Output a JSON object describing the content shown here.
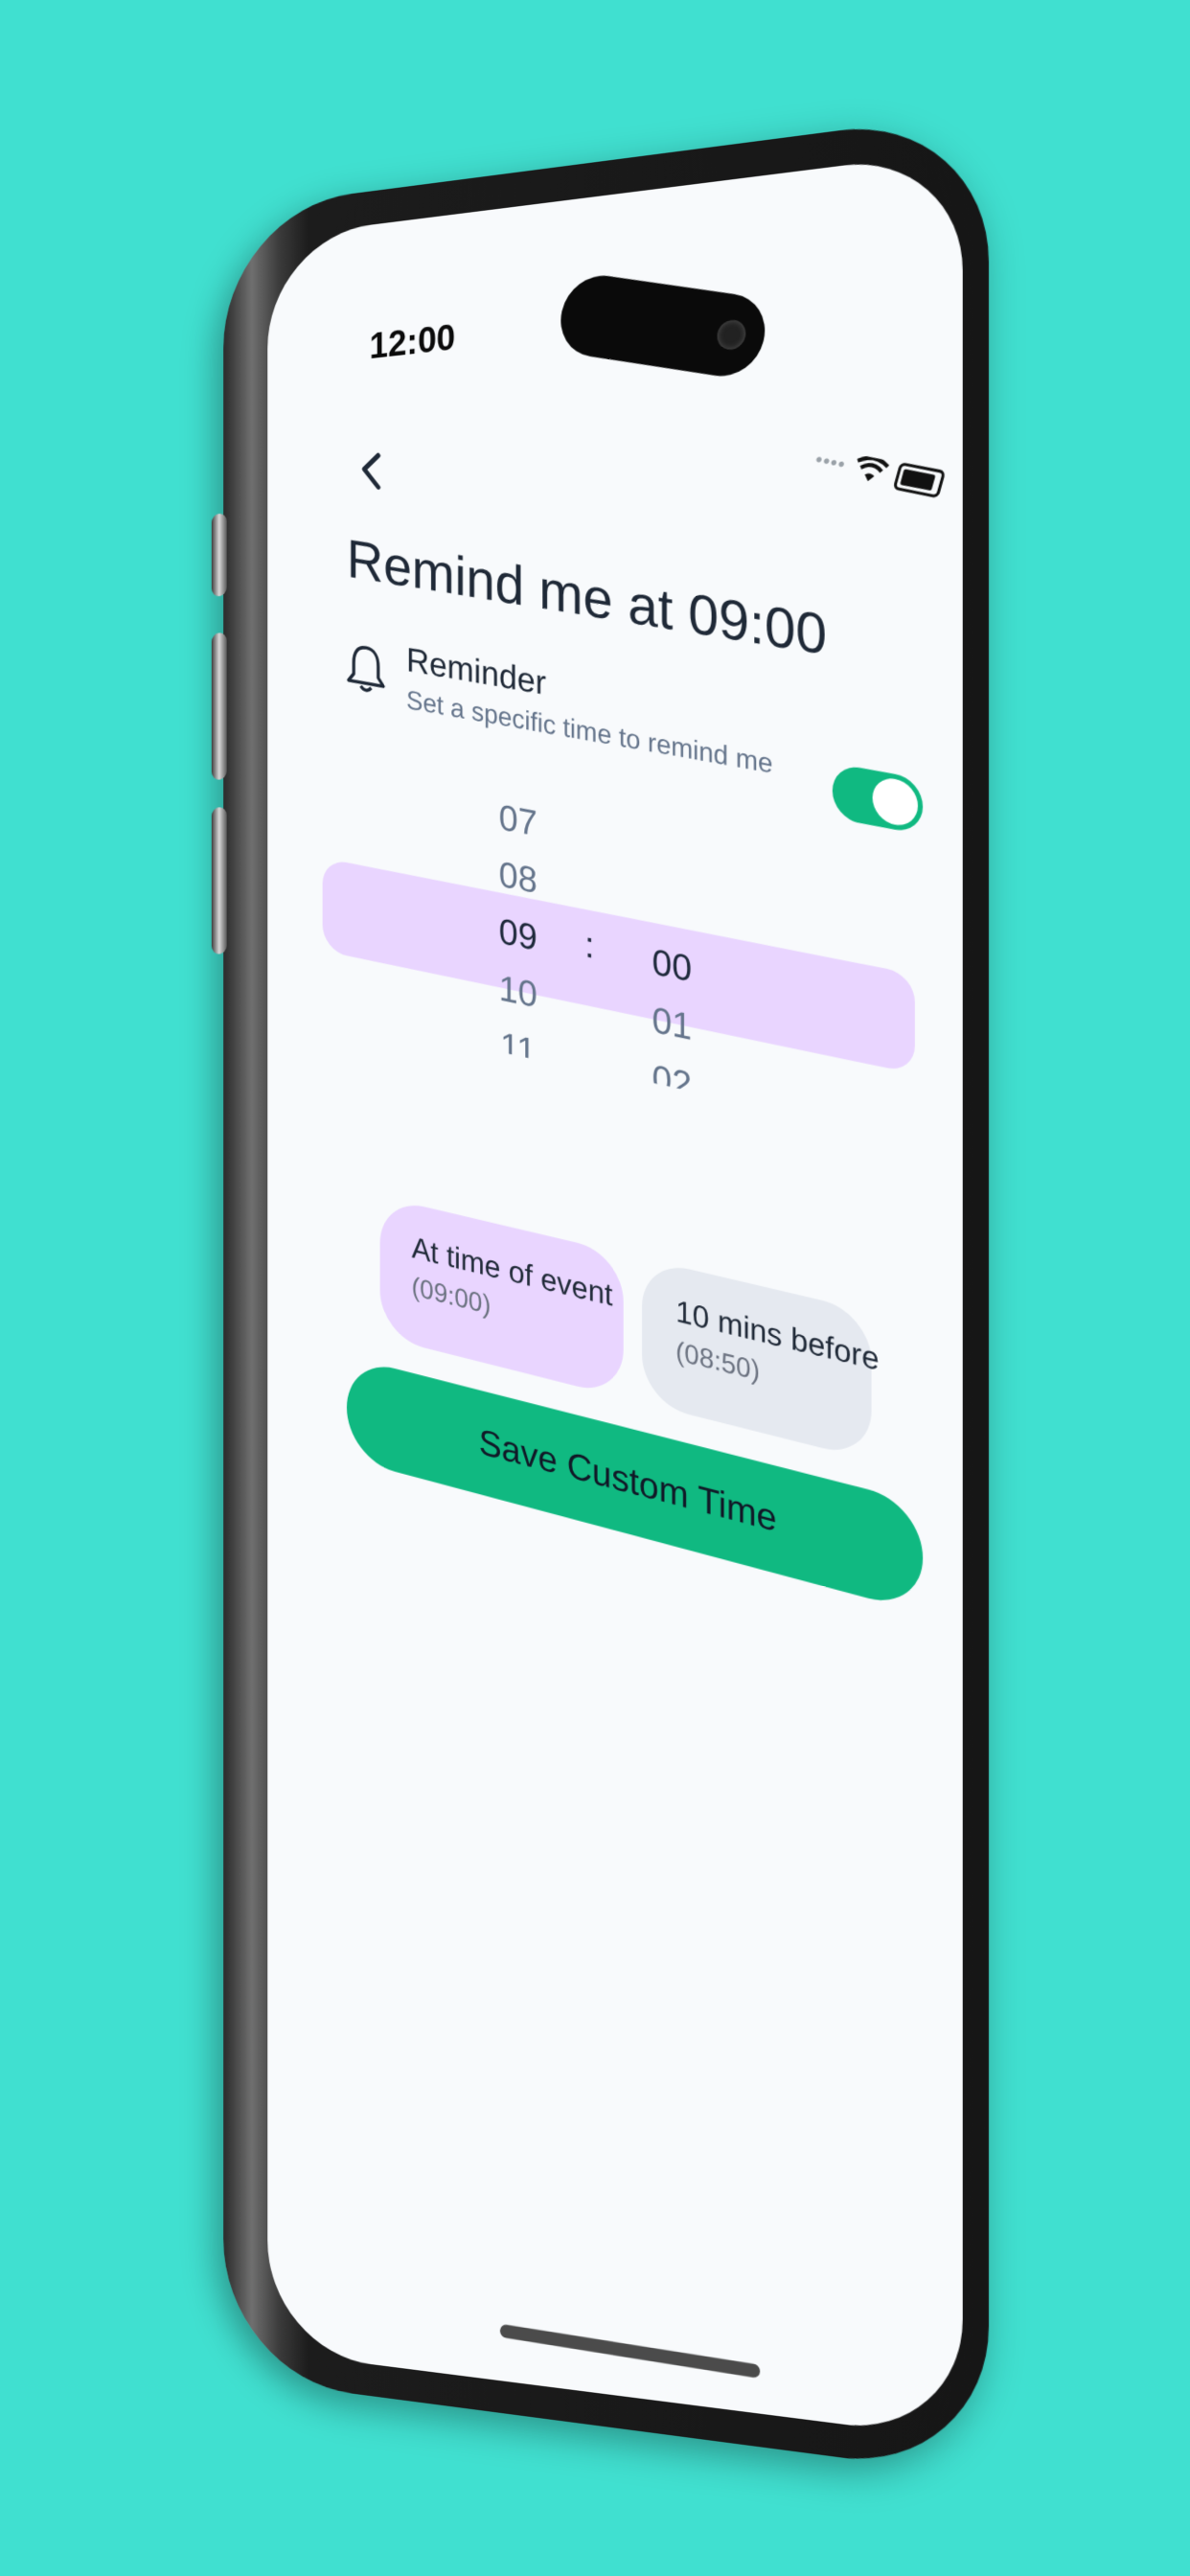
{
  "status_bar": {
    "time": "12:00"
  },
  "header": {
    "back_icon": "chevron-left-icon",
    "title": "Remind me at 09:00"
  },
  "reminder": {
    "icon": "bell-icon",
    "label": "Reminder",
    "description": "Set a specific time to remind me",
    "enabled": true
  },
  "picker": {
    "hours": [
      "07",
      "08",
      "09",
      "10",
      "11"
    ],
    "minutes": [
      "00",
      "01",
      "02"
    ],
    "separator": ":",
    "selected_hour": "09",
    "selected_minute": "00"
  },
  "presets": [
    {
      "label": "At time of event",
      "time": "(09:00)",
      "selected": true
    },
    {
      "label": "10 mins before",
      "time": "(08:50)",
      "selected": false
    }
  ],
  "save_button": {
    "label": "Save Custom Time"
  },
  "colors": {
    "background": "#40E0D0",
    "accent": "#10B981",
    "selection": "#E9D5FF",
    "chip_inactive": "#E5E9F0"
  }
}
